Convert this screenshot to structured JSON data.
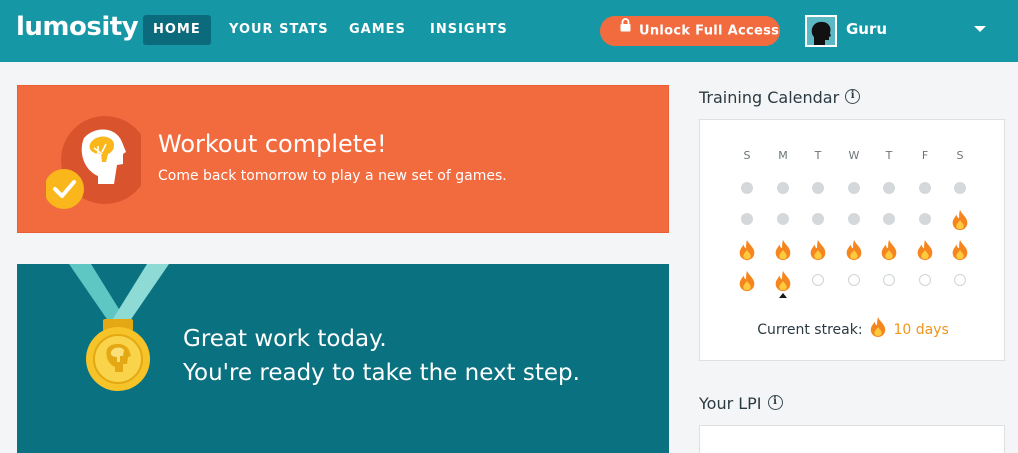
{
  "header": {
    "logo": "lumosity",
    "nav": [
      "HOME",
      "YOUR STATS",
      "GAMES",
      "INSIGHTS"
    ],
    "unlock_label": "Unlock Full Access",
    "user_name": "Guru"
  },
  "workout_card": {
    "title": "Workout complete!",
    "subtitle": "Come back tomorrow to play a new set of games."
  },
  "great_work_card": {
    "line1": "Great work today.",
    "line2": "You're ready to take the next step."
  },
  "calendar": {
    "title": "Training Calendar",
    "info_symbol": "i",
    "days": [
      "S",
      "M",
      "T",
      "W",
      "T",
      "F",
      "S"
    ],
    "weeks": [
      [
        "past",
        "past",
        "past",
        "past",
        "past",
        "past",
        "past"
      ],
      [
        "past",
        "past",
        "past",
        "past",
        "past",
        "past",
        "trained"
      ],
      [
        "trained",
        "trained",
        "trained",
        "trained",
        "trained",
        "trained",
        "trained"
      ],
      [
        "trained",
        "trained",
        "future",
        "future",
        "future",
        "future",
        "future"
      ]
    ],
    "today_index": [
      3,
      1
    ],
    "streak_label": "Current streak:",
    "streak_value": "10 days",
    "colors": {
      "flame_outer": "#f5861f",
      "flame_inner": "#fdc93f"
    }
  },
  "lpi": {
    "title": "Your LPI",
    "info_symbol": "i"
  },
  "colors": {
    "topbar": "#1597a6",
    "nav_active": "#0b6a7b",
    "accent_orange": "#f26b3f",
    "teal_card": "#0a7180",
    "streak_orange": "#f0961e"
  }
}
